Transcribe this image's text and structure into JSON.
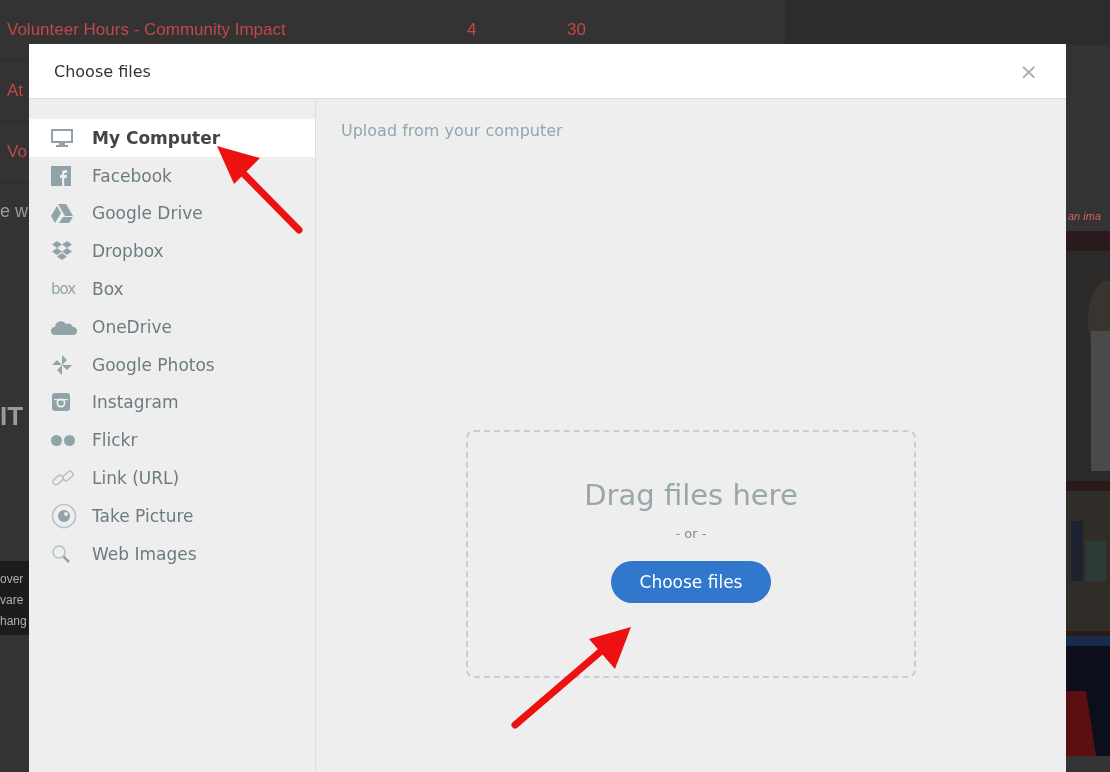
{
  "background": {
    "table_rows": [
      {
        "cells": [
          "Volunteer Hours - Community Impact",
          "4",
          "30"
        ]
      },
      {
        "cells": [
          "At"
        ]
      },
      {
        "cells": [
          "Vo"
        ]
      }
    ],
    "heading": "e w",
    "logo_text": "IT",
    "banner_lines": [
      "over",
      "vare",
      "hang"
    ],
    "caption": "an ima"
  },
  "dialog": {
    "title": "Choose files",
    "close": "×",
    "sources": [
      {
        "kind": "computer",
        "label": "My Computer",
        "selected": true
      },
      {
        "kind": "facebook",
        "label": "Facebook",
        "selected": false
      },
      {
        "kind": "drive",
        "label": "Google Drive",
        "selected": false
      },
      {
        "kind": "dropbox",
        "label": "Dropbox",
        "selected": false
      },
      {
        "kind": "box",
        "label": "Box",
        "selected": false,
        "icon_text": "box"
      },
      {
        "kind": "onedrive",
        "label": "OneDrive",
        "selected": false
      },
      {
        "kind": "photos",
        "label": "Google Photos",
        "selected": false
      },
      {
        "kind": "instagram",
        "label": "Instagram",
        "selected": false
      },
      {
        "kind": "flickr",
        "label": "Flickr",
        "selected": false
      },
      {
        "kind": "link",
        "label": "Link (URL)",
        "selected": false
      },
      {
        "kind": "camera",
        "label": "Take Picture",
        "selected": false
      },
      {
        "kind": "search",
        "label": "Web Images",
        "selected": false
      }
    ],
    "panel_title": "Upload from your computer",
    "drop_text": "Drag files here",
    "or_text": "- or -",
    "button": "Choose files"
  }
}
